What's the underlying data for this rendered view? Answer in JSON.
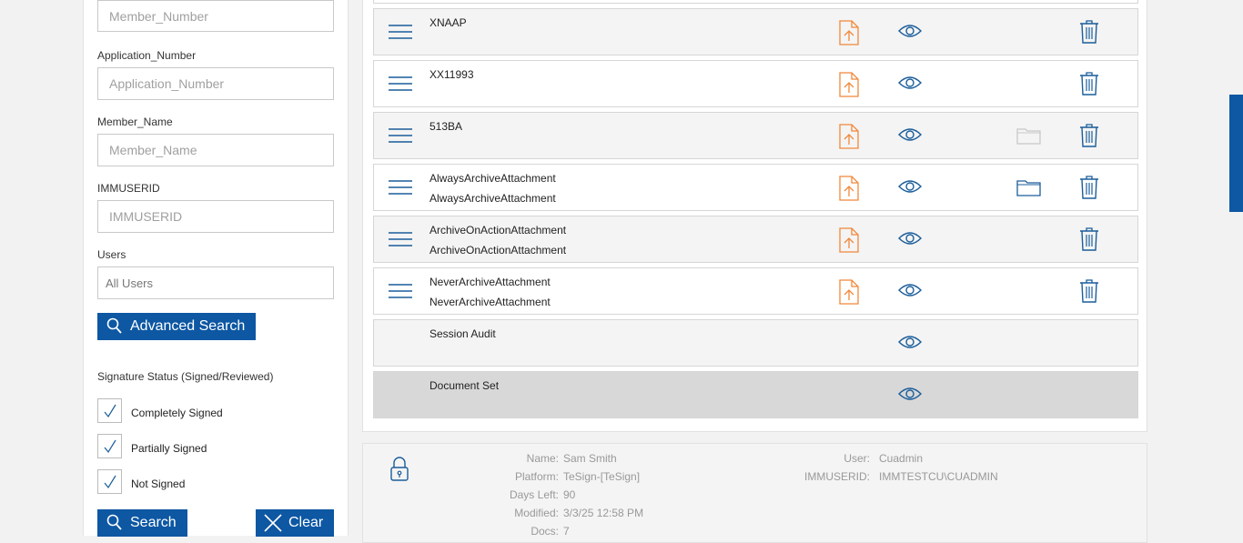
{
  "sidebar": {
    "member_number": {
      "placeholder": "Member_Number"
    },
    "application_number": {
      "label": "Application_Number",
      "placeholder": "Application_Number"
    },
    "member_name": {
      "label": "Member_Name",
      "placeholder": "Member_Name"
    },
    "immuserid": {
      "label": "IMMUSERID",
      "placeholder": "IMMUSERID"
    },
    "users": {
      "label": "Users",
      "value": "All Users"
    },
    "advanced_search_label": "Advanced Search",
    "signature_status_label": "Signature Status (Signed/Reviewed)",
    "checkboxes": [
      {
        "label": "Completely Signed",
        "checked": true
      },
      {
        "label": "Partially Signed",
        "checked": true
      },
      {
        "label": "Not Signed",
        "checked": true
      }
    ],
    "search_label": "Search",
    "clear_label": "Clear"
  },
  "documents": [
    {
      "title": "XNAAP",
      "subtitle": ""
    },
    {
      "title": "XX11993",
      "subtitle": ""
    },
    {
      "title": "513BA",
      "subtitle": ""
    },
    {
      "title": "AlwaysArchiveAttachment",
      "subtitle": "AlwaysArchiveAttachment"
    },
    {
      "title": "ArchiveOnActionAttachment",
      "subtitle": "ArchiveOnActionAttachment"
    },
    {
      "title": "NeverArchiveAttachment",
      "subtitle": "NeverArchiveAttachment"
    },
    {
      "title": "Session Audit",
      "subtitle": ""
    },
    {
      "title": "Document Set",
      "subtitle": ""
    }
  ],
  "info": {
    "name_key": "Name:",
    "name_val": "Sam Smith",
    "platform_key": "Platform:",
    "platform_val": "TeSign-[TeSign]",
    "days_key": "Days Left:",
    "days_val": "90",
    "modified_key": "Modified:",
    "modified_val": "3/3/25 12:58 PM",
    "docs_key": "Docs:",
    "docs_val": "7",
    "user_key": "User:",
    "user_val": "Cuadmin",
    "immuserid_key": "IMMUSERID:",
    "immuserid_val": "IMMTESTCU\\CUADMIN"
  },
  "colors": {
    "accent": "#0d57a3",
    "upload": "#f0883a",
    "icon_blue": "#1a5d9a"
  }
}
